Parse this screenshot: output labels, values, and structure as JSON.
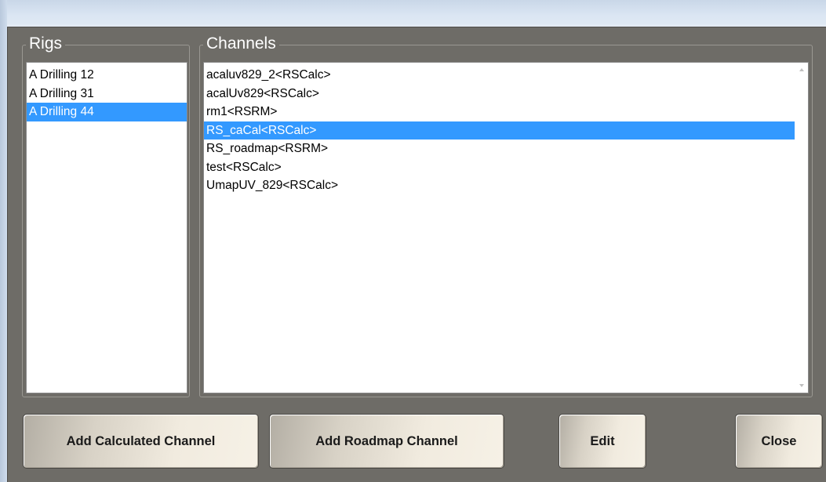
{
  "rigs": {
    "title": "Rigs",
    "items": [
      {
        "label": "A Drilling 12",
        "selected": false
      },
      {
        "label": "A Drilling 31",
        "selected": false
      },
      {
        "label": "A Drilling 44",
        "selected": true
      }
    ]
  },
  "channels": {
    "title": "Channels",
    "items": [
      {
        "label": "acaluv829_2<RSCalc>",
        "selected": false
      },
      {
        "label": "acalUv829<RSCalc>",
        "selected": false
      },
      {
        "label": "rm1<RSRM>",
        "selected": false
      },
      {
        "label": "RS_caCal<RSCalc>",
        "selected": true
      },
      {
        "label": "RS_roadmap<RSRM>",
        "selected": false
      },
      {
        "label": "test<RSCalc>",
        "selected": false
      },
      {
        "label": "UmapUV_829<RSCalc>",
        "selected": false
      }
    ]
  },
  "buttons": {
    "add_calculated": "Add Calculated Channel",
    "add_roadmap": "Add Roadmap Channel",
    "edit": "Edit",
    "close": "Close"
  },
  "colors": {
    "background": "#6e6c67",
    "selection": "#3399ff"
  }
}
